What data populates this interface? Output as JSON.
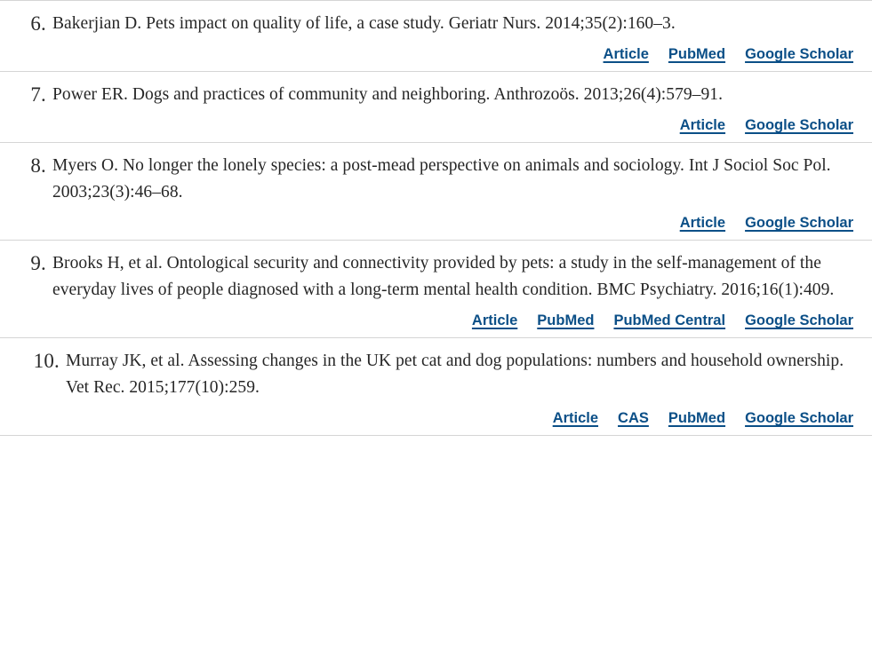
{
  "page": {
    "type": "reference-list",
    "link_color": "#0b4f87",
    "text_color": "#262626",
    "divider_color": "#d5d5d5"
  },
  "references": [
    {
      "number": "6.",
      "citation": "Bakerjian D. Pets impact on quality of life, a case study. Geriatr Nurs. 2014;35(2):160–3.",
      "links": [
        "Article",
        "PubMed",
        "Google Scholar"
      ]
    },
    {
      "number": "7.",
      "citation": "Power ER. Dogs and practices of community and neighboring. Anthrozoös. 2013;26(4):579–91.",
      "links": [
        "Article",
        "Google Scholar"
      ]
    },
    {
      "number": "8.",
      "citation": "Myers O. No longer the lonely species: a post-mead perspective on animals and sociology. Int J Sociol Soc Pol. 2003;23(3):46–68.",
      "links": [
        "Article",
        "Google Scholar"
      ]
    },
    {
      "number": "9.",
      "citation": "Brooks H, et al. Ontological security and connectivity provided by pets: a study in the self-management of the everyday lives of people diagnosed with a long-term mental health condition. BMC Psychiatry. 2016;16(1):409.",
      "links": [
        "Article",
        "PubMed",
        "PubMed Central",
        "Google Scholar"
      ]
    },
    {
      "number": "10.",
      "citation": "Murray JK, et al. Assessing changes in the UK pet cat and dog populations: numbers and household ownership. Vet Rec. 2015;177(10):259.",
      "links": [
        "Article",
        "CAS",
        "PubMed",
        "Google Scholar"
      ]
    }
  ]
}
